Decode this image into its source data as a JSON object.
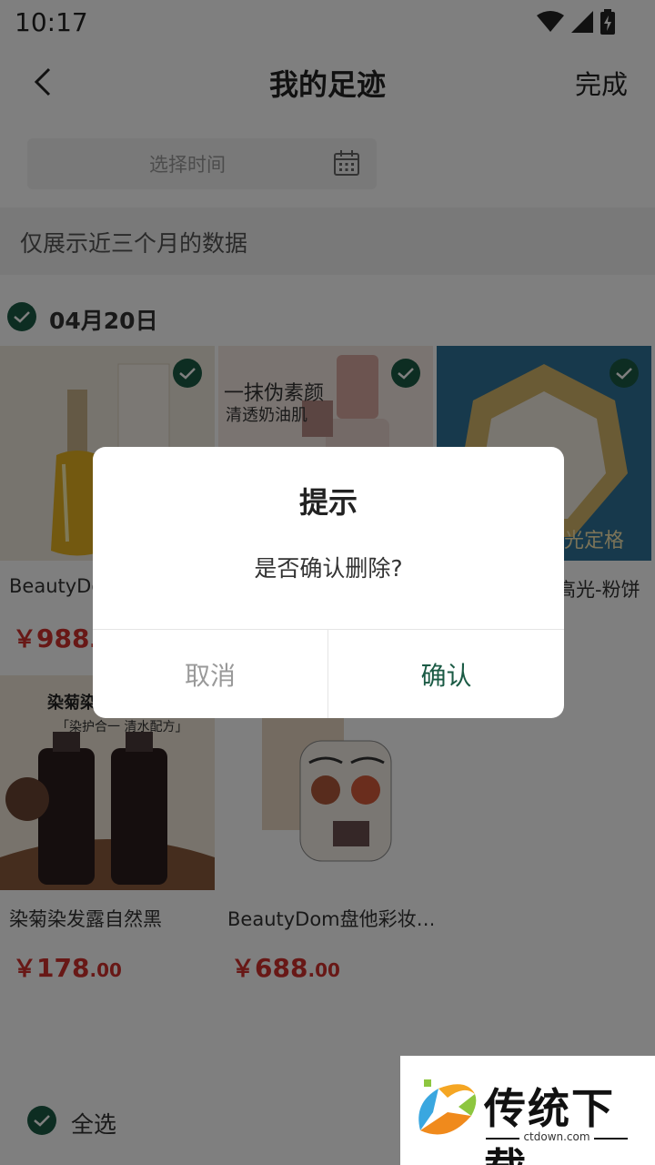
{
  "status_bar": {
    "time": "10:17"
  },
  "nav": {
    "title": "我的足迹",
    "done_label": "完成"
  },
  "date_picker": {
    "placeholder": "选择时间"
  },
  "notice": {
    "text": "仅展示近三个月的数据"
  },
  "date_group": {
    "label": "04月20日",
    "checked": true
  },
  "products": [
    {
      "name": "BeautyDom",
      "price_symbol": "￥",
      "price_int": "988",
      "price_dec": ".0",
      "checked": true
    },
    {
      "name": "",
      "price_symbol": "",
      "price_int": "",
      "price_dec": "",
      "checked": true,
      "image_text_1": "一抹伪素颜",
      "image_text_2": "清透奶油肌"
    },
    {
      "name": "高光-粉饼",
      "price_symbol": "",
      "price_int": "",
      "price_dec": "",
      "checked": true,
      "image_text_1": "光定格"
    },
    {
      "name": "染菊染发露自然黑",
      "price_symbol": "￥",
      "price_int": "178",
      "price_dec": ".00",
      "checked": false,
      "image_text_1": "染菊染",
      "image_text_2": "「染护合一 清水配方」"
    },
    {
      "name": "BeautyDom盘他彩妆…",
      "price_symbol": "￥",
      "price_int": "688",
      "price_dec": ".00",
      "checked": false
    }
  ],
  "footer": {
    "select_all_label": "全选",
    "checked": true
  },
  "dialog": {
    "title": "提示",
    "message": "是否确认删除?",
    "cancel_label": "取消",
    "confirm_label": "确认"
  },
  "watermark": {
    "name": "传统下载",
    "url": "ctdown.com"
  },
  "colors": {
    "accent": "#1a5a44",
    "price": "#d0312d",
    "overlay": "rgba(0,0,0,0.5)"
  }
}
